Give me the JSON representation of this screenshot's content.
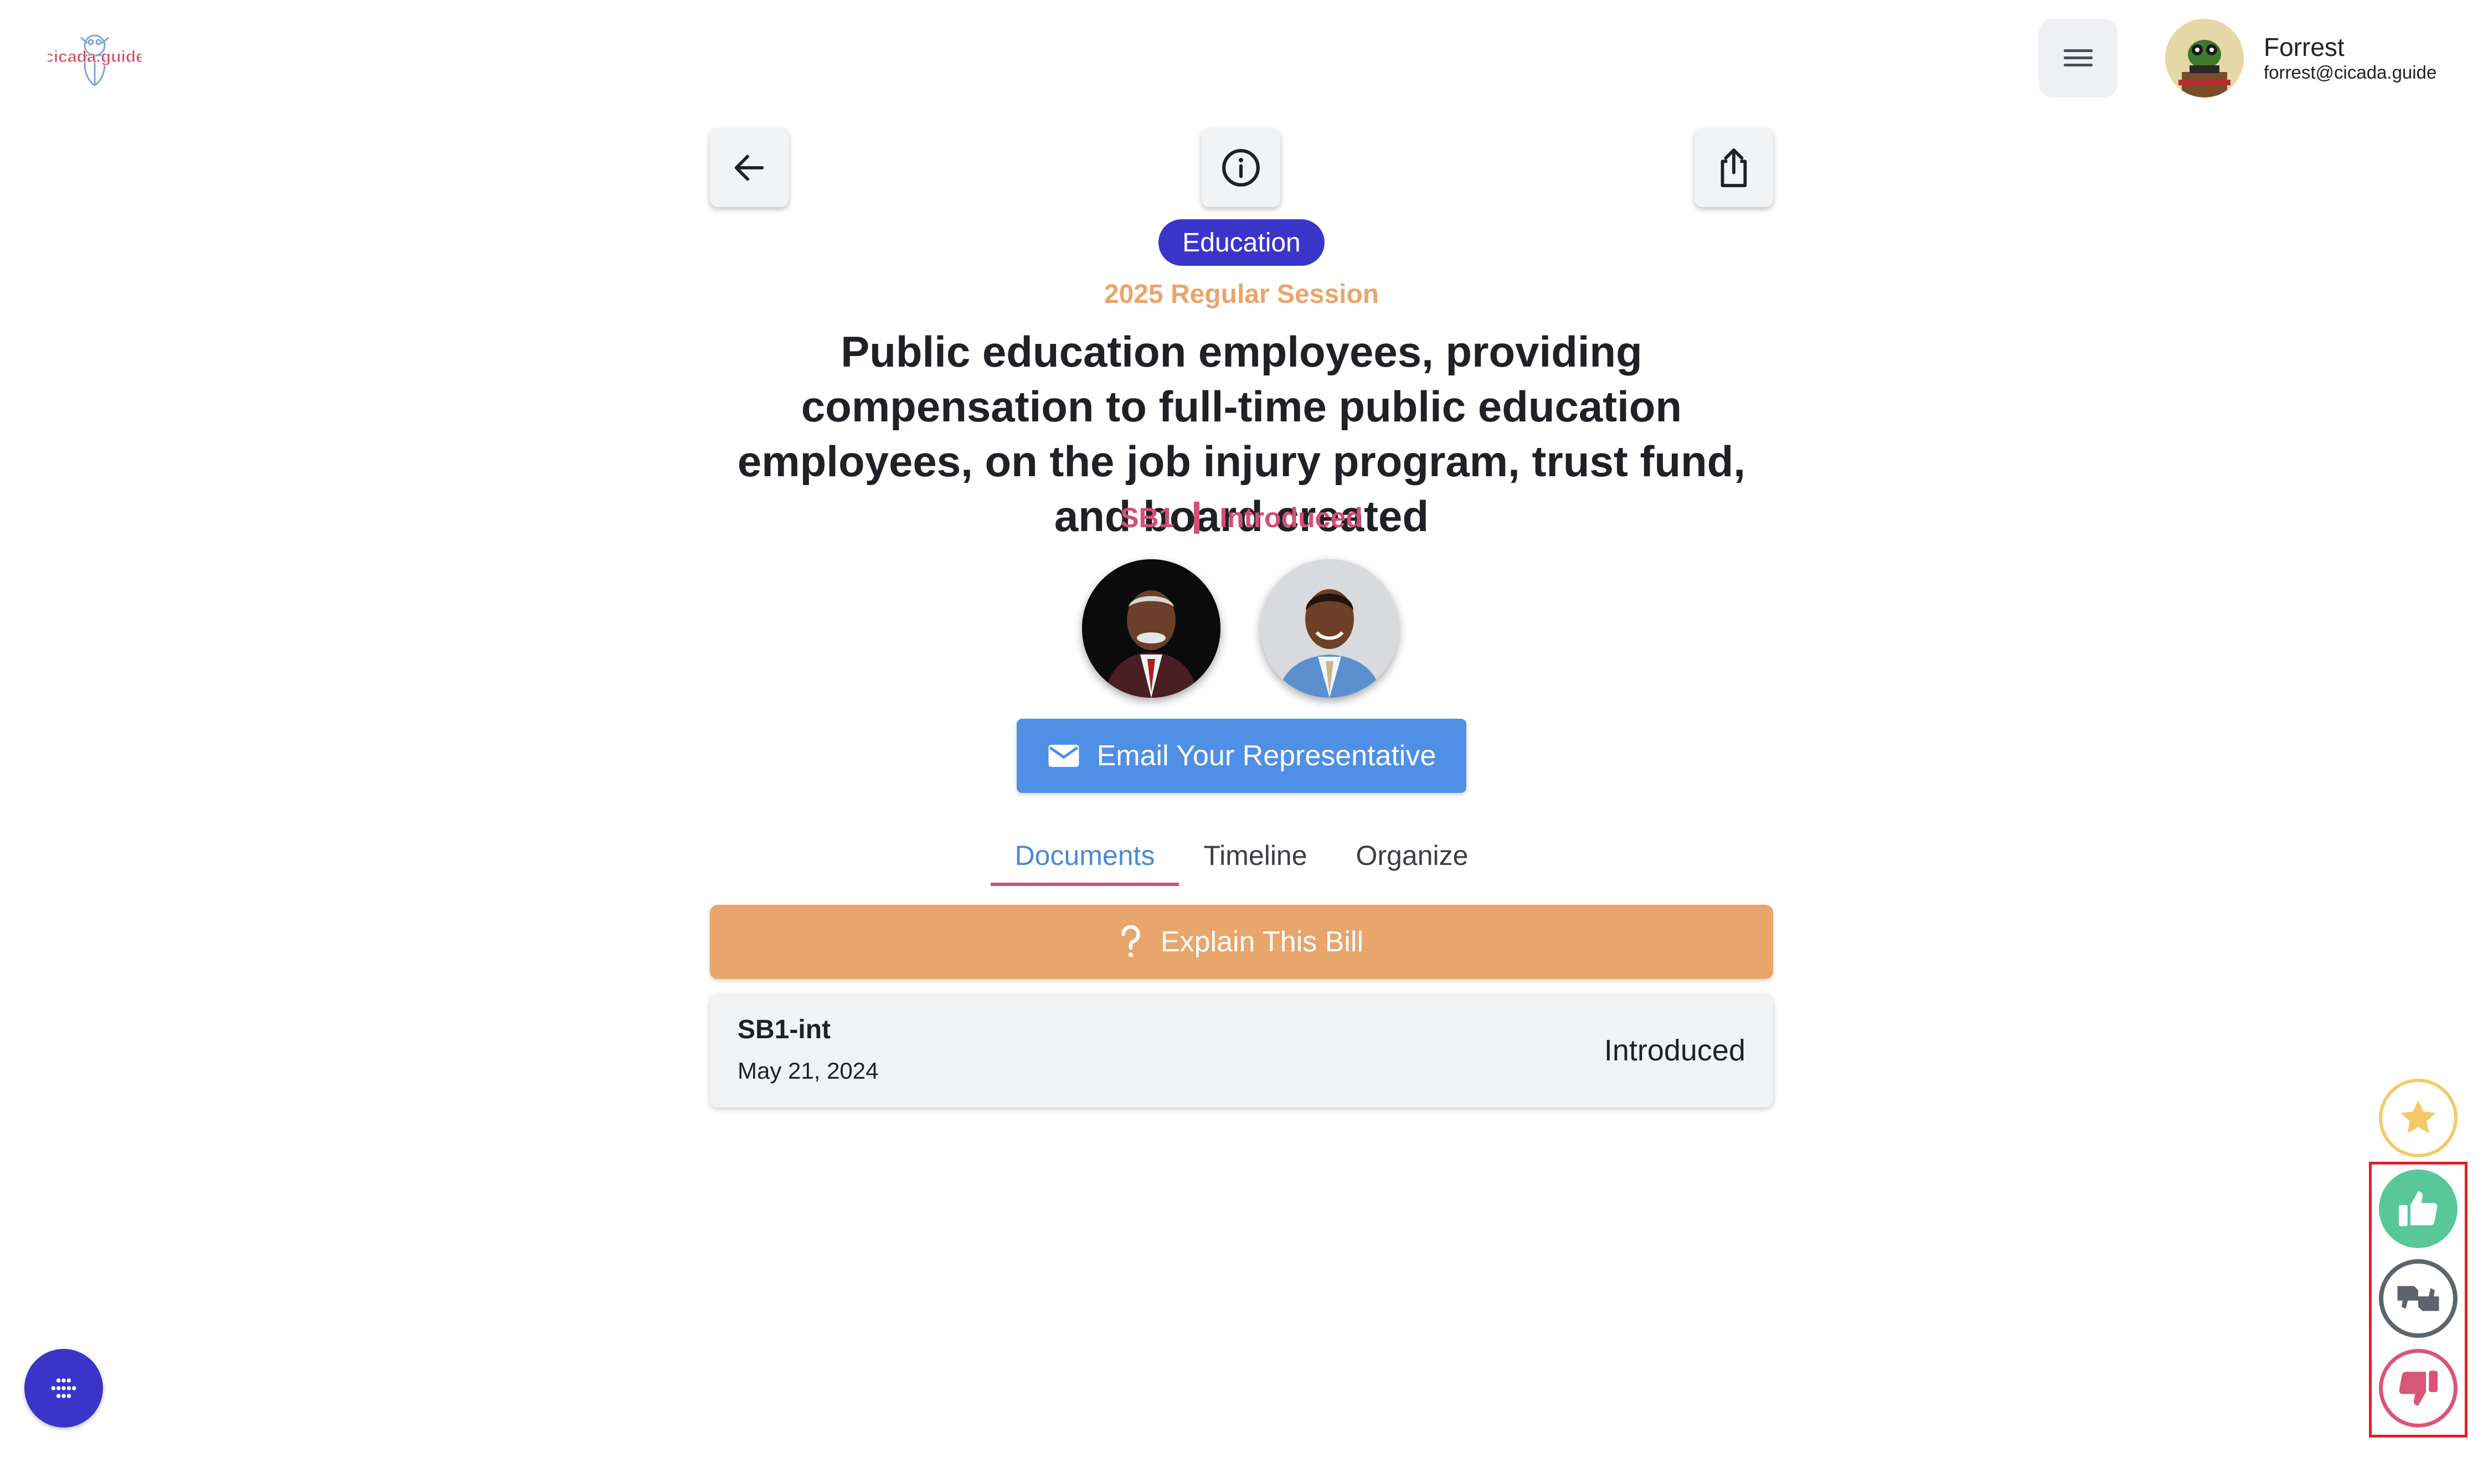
{
  "header": {
    "logo_text": "cicada.guide",
    "user": {
      "name": "Forrest",
      "email": "forrest@cicada.guide"
    }
  },
  "bill": {
    "topic": "Education",
    "session": "2025 Regular Session",
    "title": "Public education employees, providing compensation to full-time public education employees, on the job injury program, trust fund, and board created",
    "number": "SB1",
    "status": "Introduced"
  },
  "actions": {
    "email_rep": "Email Your Representative",
    "explain": "Explain This Bill"
  },
  "tabs": [
    {
      "label": "Documents",
      "active": true
    },
    {
      "label": "Timeline",
      "active": false
    },
    {
      "label": "Organize",
      "active": false
    }
  ],
  "documents": [
    {
      "name": "SB1-int",
      "date": "May 21, 2024",
      "status": "Introduced"
    }
  ],
  "colors": {
    "brand_indigo": "#3a35c9",
    "accent_orange": "#e8a56c",
    "accent_pink": "#d44f75",
    "email_blue": "#4f8fe6",
    "vote_up": "#58c898",
    "vote_down": "#d85678",
    "favorite": "#f5c96a"
  },
  "icons": {
    "menu": "hamburger-icon",
    "back": "arrow-left-icon",
    "info": "info-circle-icon",
    "share": "share-icon",
    "email": "envelope-icon",
    "explain": "question-mark-icon",
    "favorite": "star-icon",
    "vote_up": "thumbs-up-icon",
    "vote_neutral": "thumbs-sideways-icon",
    "vote_down": "thumbs-down-icon",
    "apps": "dots-grid-icon"
  }
}
